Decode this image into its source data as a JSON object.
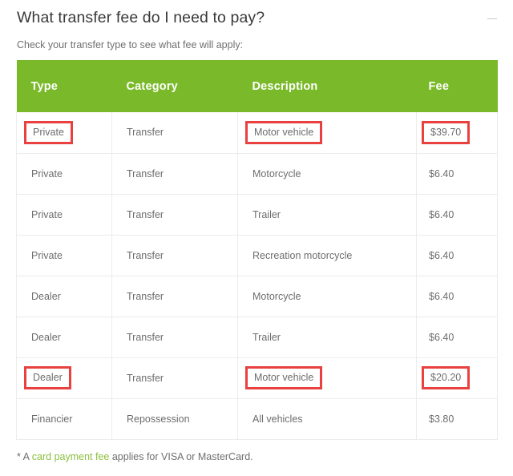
{
  "panel": {
    "title": "What transfer fee do I need to pay?",
    "collapse_icon": "minus-icon",
    "subtitle": "Check your transfer type to see what fee will apply:"
  },
  "colors": {
    "header_green": "#7ab929",
    "highlight_red": "#e8413f",
    "link_green": "#8cbf3f",
    "body_text": "#6d6d6d",
    "grid_line": "#ececec"
  },
  "table": {
    "columns": [
      "Type",
      "Category",
      "Description",
      "Fee"
    ],
    "rows": [
      {
        "type": "Private",
        "category": "Transfer",
        "description": "Motor vehicle",
        "fee": "$39.70",
        "highlight": [
          "type",
          "description",
          "fee"
        ]
      },
      {
        "type": "Private",
        "category": "Transfer",
        "description": "Motorcycle",
        "fee": "$6.40",
        "highlight": []
      },
      {
        "type": "Private",
        "category": "Transfer",
        "description": "Trailer",
        "fee": "$6.40",
        "highlight": []
      },
      {
        "type": "Private",
        "category": "Transfer",
        "description": "Recreation motorcycle",
        "fee": "$6.40",
        "highlight": []
      },
      {
        "type": "Dealer",
        "category": "Transfer",
        "description": "Motorcycle",
        "fee": "$6.40",
        "highlight": []
      },
      {
        "type": "Dealer",
        "category": "Transfer",
        "description": "Trailer",
        "fee": "$6.40",
        "highlight": []
      },
      {
        "type": "Dealer",
        "category": "Transfer",
        "description": "Motor vehicle",
        "fee": "$20.20",
        "highlight": [
          "type",
          "description",
          "fee"
        ]
      },
      {
        "type": "Financier",
        "category": "Repossession",
        "description": "All vehicles",
        "fee": "$3.80",
        "highlight": []
      }
    ]
  },
  "footnote": {
    "prefix": "* A ",
    "link_text": "card payment fee",
    "suffix": " applies for VISA or MasterCard."
  }
}
